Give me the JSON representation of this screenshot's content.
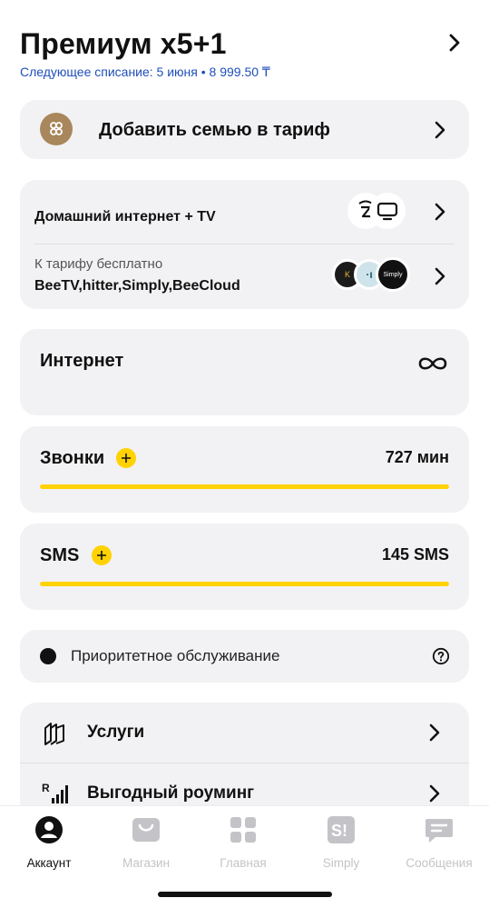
{
  "header": {
    "title": "Премиум x5+1",
    "subtitle": "Следующее списание: 5 июня • 8 999.50 ₸"
  },
  "family": {
    "label": "Добавить семью в тариф"
  },
  "home_internet": {
    "label": "Домашний интернет + TV",
    "free_caption": "К тарифу бесплатно",
    "free_list": "BeeTV,hitter,Simply,BeeCloud",
    "logo_simply": "Simply"
  },
  "internet": {
    "title": "Интернет",
    "value_icon": "infinity-icon"
  },
  "calls": {
    "title": "Звонки",
    "value": "727 мин",
    "remaining_fraction": 1.0
  },
  "sms": {
    "title": "SMS",
    "value": "145 SMS",
    "remaining_fraction": 1.0
  },
  "priority": {
    "label": "Приоритетное обслуживание"
  },
  "list": [
    {
      "label": "Услуги",
      "icon": "services-icon"
    },
    {
      "label": "Выгодный роуминг",
      "icon": "roaming-icon"
    }
  ],
  "tabs": [
    {
      "label": "Аккаунт",
      "icon": "account-icon",
      "active": true
    },
    {
      "label": "Магазин",
      "icon": "shop-icon",
      "active": false
    },
    {
      "label": "Главная",
      "icon": "home-grid-icon",
      "active": false
    },
    {
      "label": "Simply",
      "icon": "simply-icon",
      "active": false
    },
    {
      "label": "Сообщения",
      "icon": "messages-icon",
      "active": false
    }
  ],
  "colors": {
    "accent_yellow": "#ffd200",
    "link_blue": "#1f4fb8",
    "card_bg": "#f2f2f4",
    "family_icon_bg": "#a8875c",
    "inactive_tab": "#c4c4c8"
  }
}
